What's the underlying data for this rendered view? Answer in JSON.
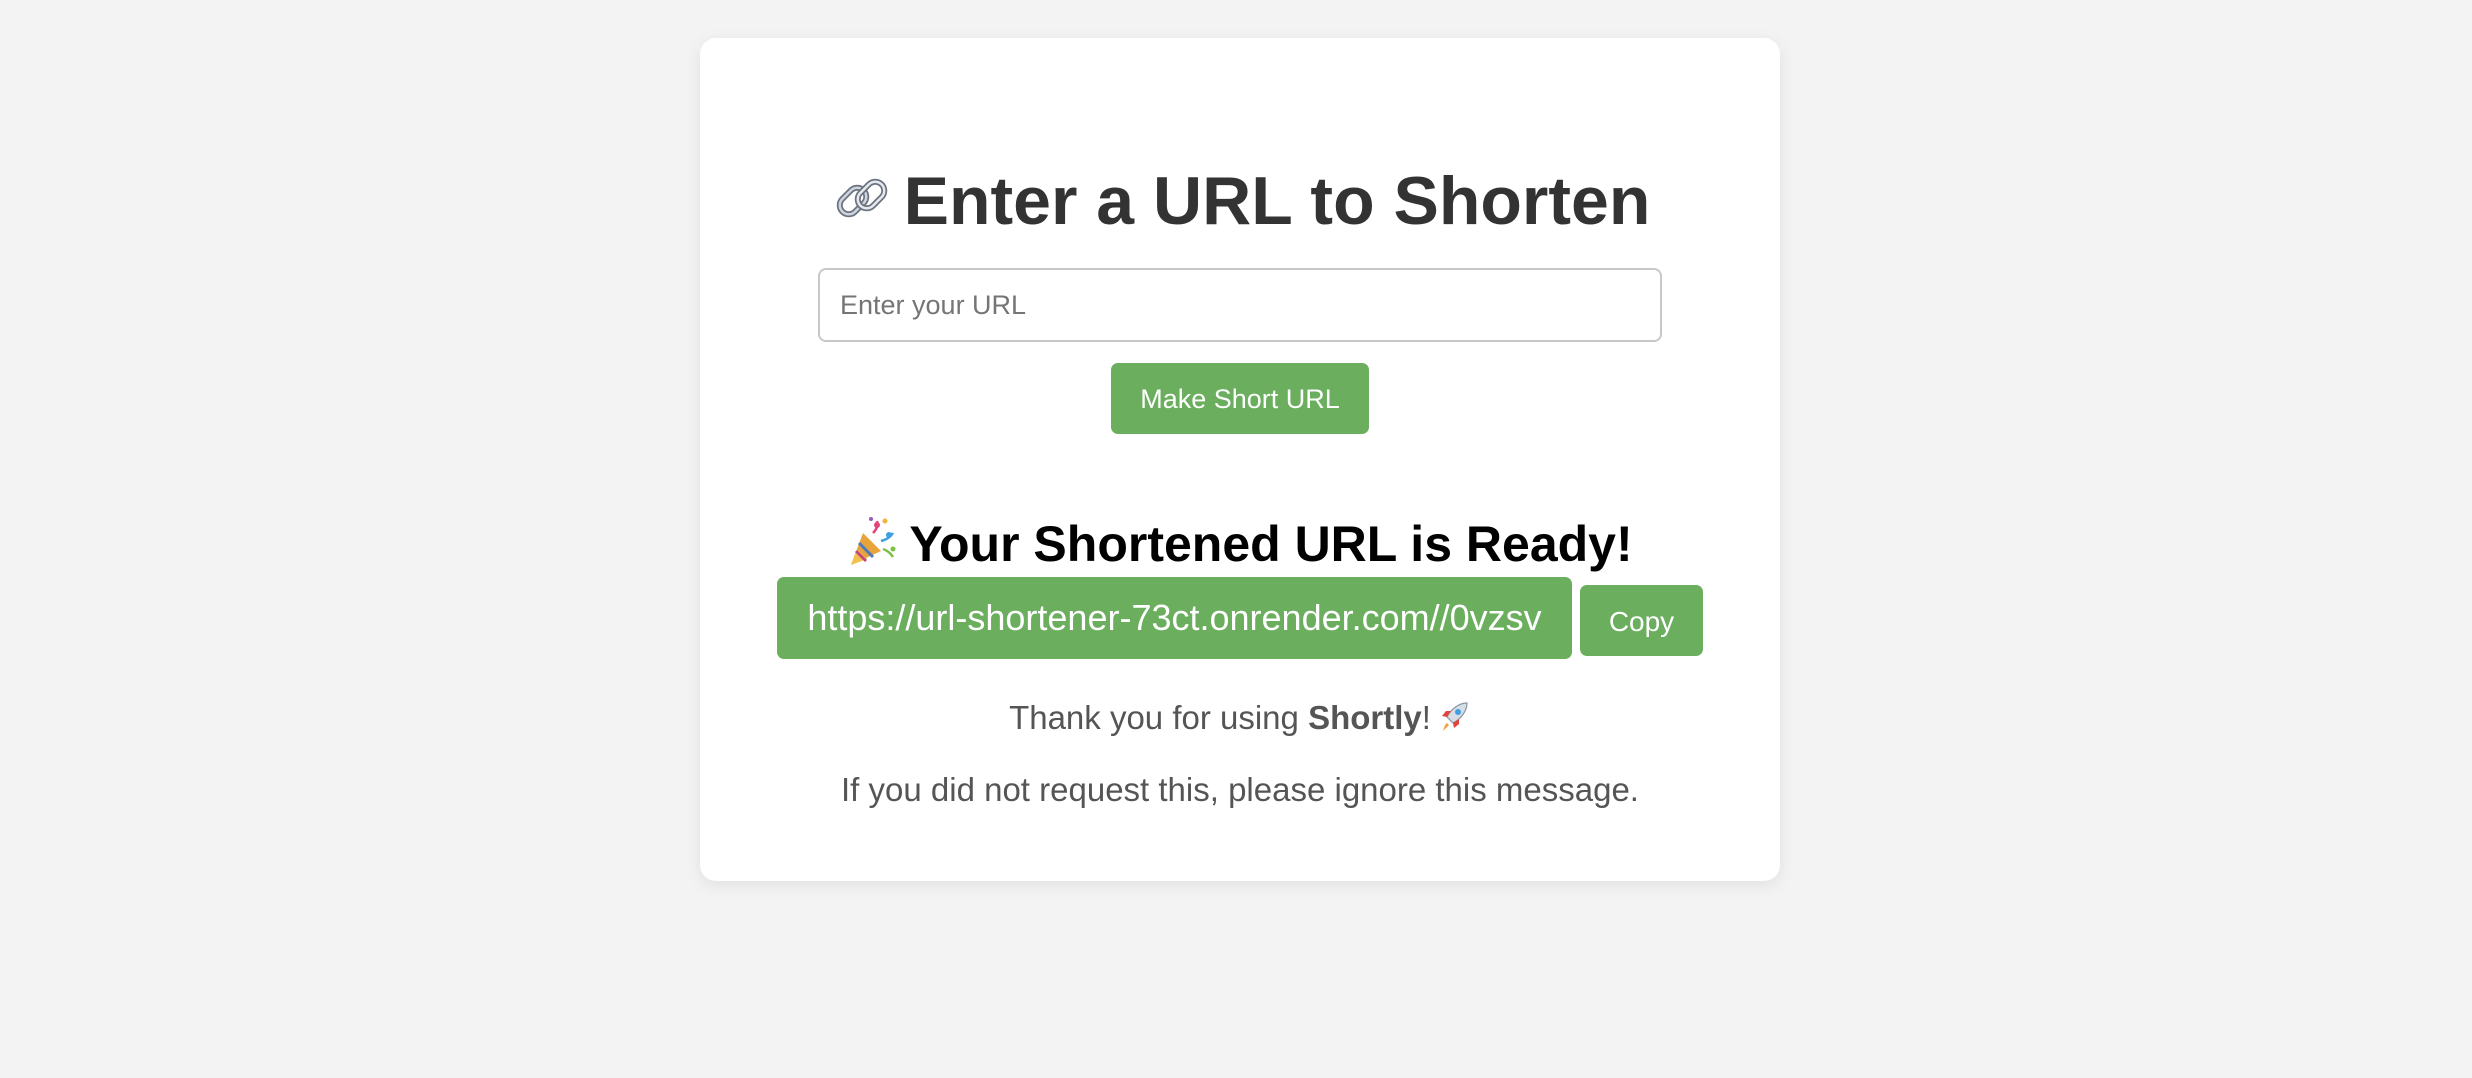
{
  "header": {
    "title": "Enter a URL to Shorten",
    "title_icon": "link-icon"
  },
  "form": {
    "url_placeholder": "Enter your URL",
    "url_value": "",
    "submit_label": "Make Short URL"
  },
  "result": {
    "heading": "Your Shortened URL is Ready!",
    "heading_icon": "party-popper-icon",
    "short_url": "https://url-shortener-73ct.onrender.com//0vzsv",
    "copy_label": "Copy"
  },
  "footer": {
    "thanks_prefix": "Thank you for using ",
    "brand": "Shortly",
    "thanks_suffix": "!",
    "thanks_icon": "rocket-icon",
    "ignore_message": "If you did not request this, please ignore this message."
  },
  "colors": {
    "accent": "#6aae5e",
    "background": "#f3f3f3",
    "card": "#ffffff",
    "title_text": "#333333",
    "body_text": "#555555"
  }
}
